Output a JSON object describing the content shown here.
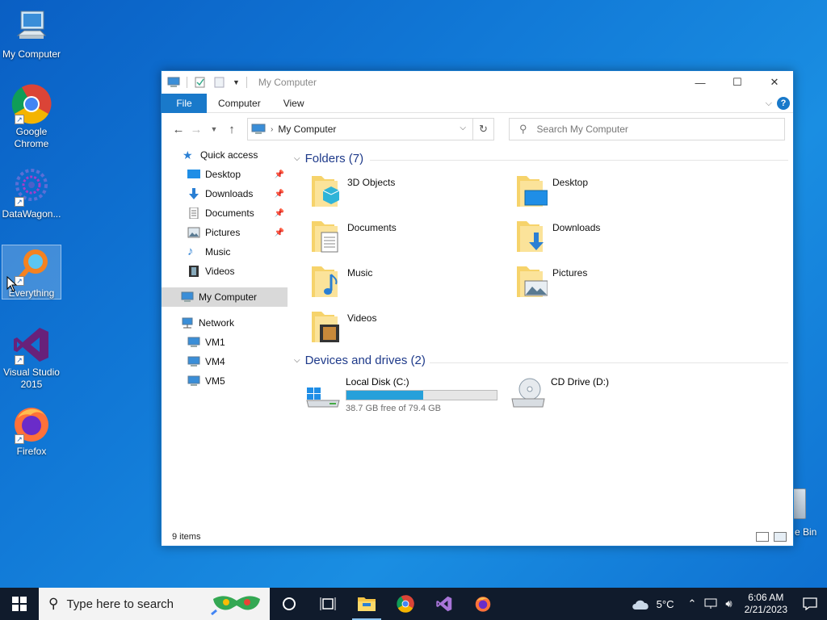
{
  "desktop": {
    "icons": [
      {
        "label": "My Computer"
      },
      {
        "label": "Google Chrome"
      },
      {
        "label": "DataWagon..."
      },
      {
        "label": "Everything"
      },
      {
        "label": "Visual Studio 2015"
      },
      {
        "label": "Firefox"
      }
    ],
    "recycle_partial_label": "e Bin"
  },
  "window": {
    "title": "My Computer",
    "ribbon": {
      "file": "File",
      "computer": "Computer",
      "view": "View"
    },
    "address": "My Computer",
    "search_placeholder": "Search My Computer",
    "nav_pane": {
      "quick_access": "Quick access",
      "quick_items": [
        "Desktop",
        "Downloads",
        "Documents",
        "Pictures",
        "Music",
        "Videos"
      ],
      "my_computer": "My Computer",
      "network": "Network",
      "network_items": [
        "VM1",
        "VM4",
        "VM5"
      ]
    },
    "folders_header": "Folders (7)",
    "folders": [
      "3D Objects",
      "Desktop",
      "Documents",
      "Downloads",
      "Music",
      "Pictures",
      "Videos"
    ],
    "drives_header": "Devices and drives (2)",
    "drives": [
      {
        "name": "Local Disk (C:)",
        "free": "38.7 GB free of 79.4 GB",
        "used_fraction": 0.513
      },
      {
        "name": "CD Drive (D:)"
      }
    ],
    "status": "9 items"
  },
  "taskbar": {
    "search_placeholder": "Type here to search",
    "weather": "5°C",
    "time": "6:06 AM",
    "date": "2/21/2023"
  },
  "colors": {
    "accent": "#1979ca",
    "bar_fill": "#26a0da",
    "taskbar": "#101b2c"
  }
}
